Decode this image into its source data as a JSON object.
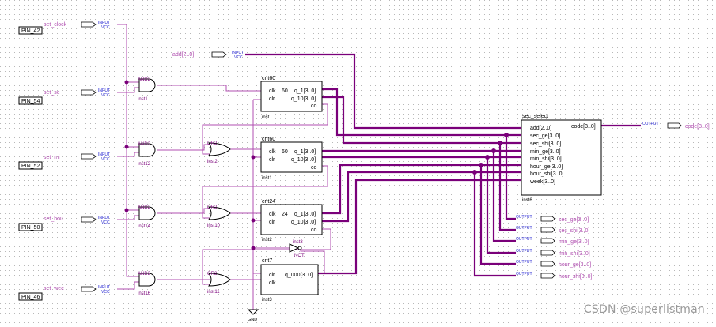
{
  "pins": [
    {
      "label": "PIN_42",
      "signal": "set_clock",
      "tag": "INPUT",
      "vcc": "VCC"
    },
    {
      "label": "PIN_54",
      "signal": "set_se",
      "tag": "INPUT",
      "vcc": "VCC"
    },
    {
      "label": "PIN_52",
      "signal": "set_mi",
      "tag": "INPUT",
      "vcc": "VCC"
    },
    {
      "label": "PIN_50",
      "signal": "set_hou",
      "tag": "INPUT",
      "vcc": "VCC"
    },
    {
      "label": "PIN_46",
      "signal": "set_wee",
      "tag": "INPUT",
      "vcc": "VCC"
    }
  ],
  "add_input": {
    "signal": "add[2..0]",
    "tag": "INPUT",
    "vcc": "VCC"
  },
  "gates": {
    "and_label": "AND2",
    "or_label": "OR2",
    "not_label": "NOT",
    "and_inst": [
      "inst1",
      "inst12",
      "inst14",
      "inst16"
    ],
    "or_inst": [
      "inst2",
      "inst10",
      "inst11"
    ],
    "not_inst": "inst3"
  },
  "counters": [
    {
      "name": "cnt60",
      "inst": "inst",
      "left_ports": [
        "clk",
        "clr"
      ],
      "right_ports": [
        "q_1[3..0]",
        "q_10[3..0]",
        "co"
      ],
      "num": "60"
    },
    {
      "name": "cnt60",
      "inst": "inst1",
      "left_ports": [
        "clk",
        "clr"
      ],
      "right_ports": [
        "q_1[3..0]",
        "q_10[3..0]",
        "co"
      ],
      "num": "60"
    },
    {
      "name": "cnt24",
      "inst": "inst2",
      "left_ports": [
        "clk",
        "clr"
      ],
      "right_ports": [
        "q_1[3..0]",
        "q_10[3..0]",
        "co"
      ],
      "num": "24"
    },
    {
      "name": "cnt7",
      "inst": "inst3",
      "left_ports": [
        "clr",
        "clk"
      ],
      "right_ports": [
        "q_000[3..0]"
      ]
    }
  ],
  "sec_select": {
    "name": "sec_select",
    "inst": "inst6",
    "inputs": [
      "add[2..0]",
      "sec_ge[3..0]",
      "sec_shi[3..0]",
      "min_ge[3..0]",
      "min_shi[3..0]",
      "hour_ge[3..0]",
      "hour_shi[3..0]",
      "week[3..0]"
    ],
    "output": "code[3..0]"
  },
  "code_output": {
    "tag": "OUTPUT",
    "signal": "code[3..0]"
  },
  "outputs": [
    {
      "tag": "OUTPUT",
      "signal": "sec_ge[3..0]"
    },
    {
      "tag": "OUTPUT",
      "signal": "sec_shi[3..0]"
    },
    {
      "tag": "OUTPUT",
      "signal": "min_ge[3..0]"
    },
    {
      "tag": "OUTPUT",
      "signal": "min_shi[3..0]"
    },
    {
      "tag": "OUTPUT",
      "signal": "hour_ge[3..0]"
    },
    {
      "tag": "OUTPUT",
      "signal": "hour_shi[3..0]"
    }
  ],
  "gnd_label": "GND",
  "watermark": "CSDN @superlistman",
  "colors": {
    "wire": "#b04fb0",
    "bus": "#7a007a",
    "pin": "#1f1fd0",
    "dot_grid": "#b8b8b8",
    "box": "#000000"
  }
}
